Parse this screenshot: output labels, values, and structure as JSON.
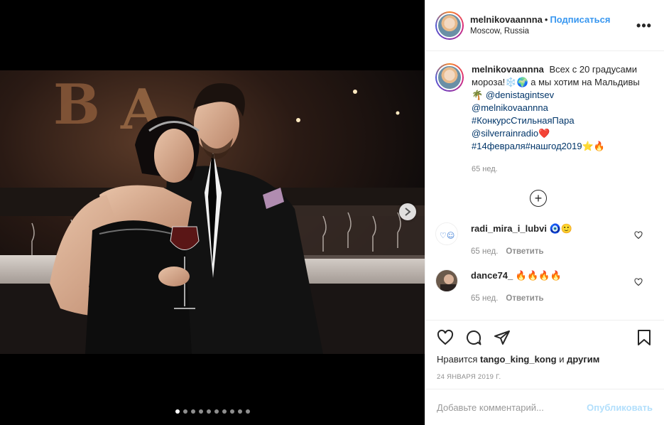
{
  "header": {
    "username": "melnikovaannna",
    "separator": "•",
    "follow_label": "Подписаться",
    "location": "Moscow, Russia",
    "more_label": "•••"
  },
  "caption": {
    "username": "melnikovaannna",
    "text_1": "Всех с 20 градусами мороза!❄️🌍 а мы хотим на Мальдивы🌴",
    "mention_1": "@denistagintsev",
    "mention_2": "@melnikovaannna",
    "hashtag_1": "#КонкурсСтильнаяПара",
    "mention_3": "@silverrainradio",
    "emoji_heart": "❤️",
    "hashtag_2": "#14февраля#нашгод2019",
    "emoji_tail": "⭐🔥",
    "time": "65 нед."
  },
  "load_more_label": "+",
  "comments": [
    {
      "username": "radi_mira_i_lubvi",
      "text": "🧿🙂",
      "time": "65 нед.",
      "reply": "Ответить"
    },
    {
      "username": "dance74_",
      "text": "🔥🔥🔥🔥",
      "time": "65 нед.",
      "reply": "Ответить"
    }
  ],
  "likes": {
    "prefix": "Нравится",
    "user": "tango_king_kong",
    "suffix": "и",
    "others": "другим"
  },
  "date": "24 ЯНВАРЯ 2019 Г.",
  "add_comment": {
    "placeholder": "Добавьте комментарий...",
    "publish_label": "Опубликовать"
  },
  "carousel": {
    "count": 10,
    "active_index": 0
  },
  "colors": {
    "link": "#003569",
    "follow": "#3897f0",
    "publish_disabled": "#b2dffc",
    "muted": "#8e8e8e"
  }
}
